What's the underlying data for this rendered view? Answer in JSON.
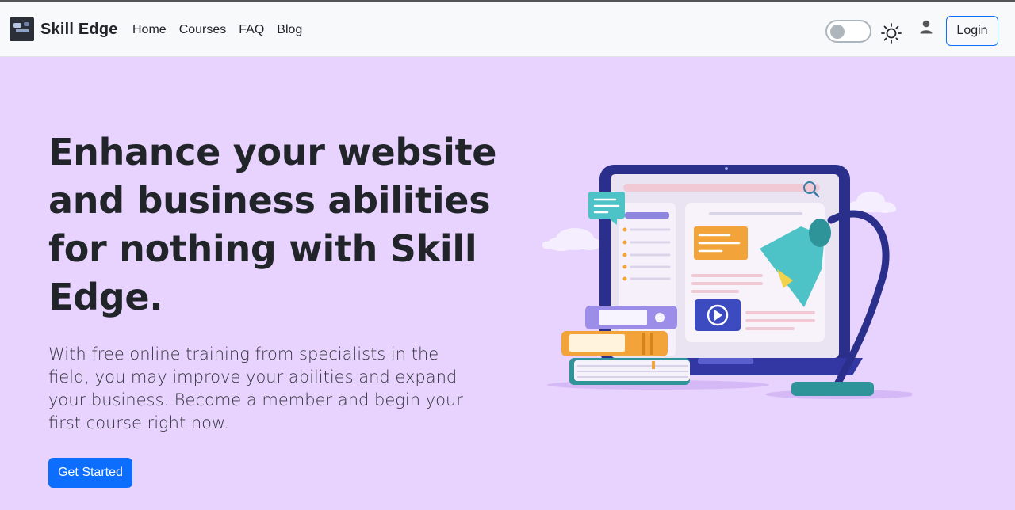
{
  "navbar": {
    "brand": "Skill Edge",
    "links": [
      "Home",
      "Courses",
      "FAQ",
      "Blog"
    ],
    "login_label": "Login"
  },
  "hero": {
    "title": "Enhance your website and business abilities for nothing with Skill Edge.",
    "text": "With free online training from specialists in the field, you may improve your abilities and expand your business. Become a member and begin your first course right now.",
    "cta_label": "Get Started"
  },
  "icons": {
    "theme_toggle": "toggle-switch",
    "theme": "sun-icon",
    "account": "user-icon",
    "logo": "brand-logo"
  },
  "colors": {
    "background": "#e7d3fd",
    "navbar": "#f8f9fa",
    "primary": "#0d6efd",
    "text": "#212529"
  }
}
